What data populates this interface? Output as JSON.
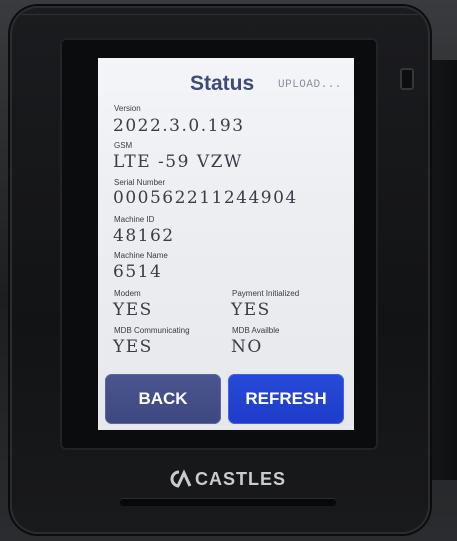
{
  "screen": {
    "title": "Status",
    "upload_status": "UPLOAD...",
    "fields": {
      "version": {
        "label": "Version",
        "value": "2022.3.0.193"
      },
      "gsm": {
        "label": "GSM",
        "value": "LTE -59 VZW"
      },
      "serial_number": {
        "label": "Serial Number",
        "value": "000562211244904"
      },
      "machine_id": {
        "label": "Machine ID",
        "value": "48162"
      },
      "machine_name": {
        "label": "Machine Name",
        "value": "6514"
      },
      "modem": {
        "label": "Modem",
        "value": "YES"
      },
      "payment_initialized": {
        "label": "Payment Initialized",
        "value": "YES"
      },
      "mdb_communicating": {
        "label": "MDB Communicating",
        "value": "YES"
      },
      "mdb_available": {
        "label": "MDB Availble",
        "value": "NO"
      }
    },
    "buttons": {
      "back": "BACK",
      "refresh": "REFRESH"
    }
  },
  "device": {
    "brand": "CASTLES",
    "logo_icon": "castles-logo-icon"
  },
  "colors": {
    "title": "#3d4a7a",
    "back_button": "#434d88",
    "refresh_button": "#2344d2",
    "screen_bg": "#eef0f4"
  }
}
